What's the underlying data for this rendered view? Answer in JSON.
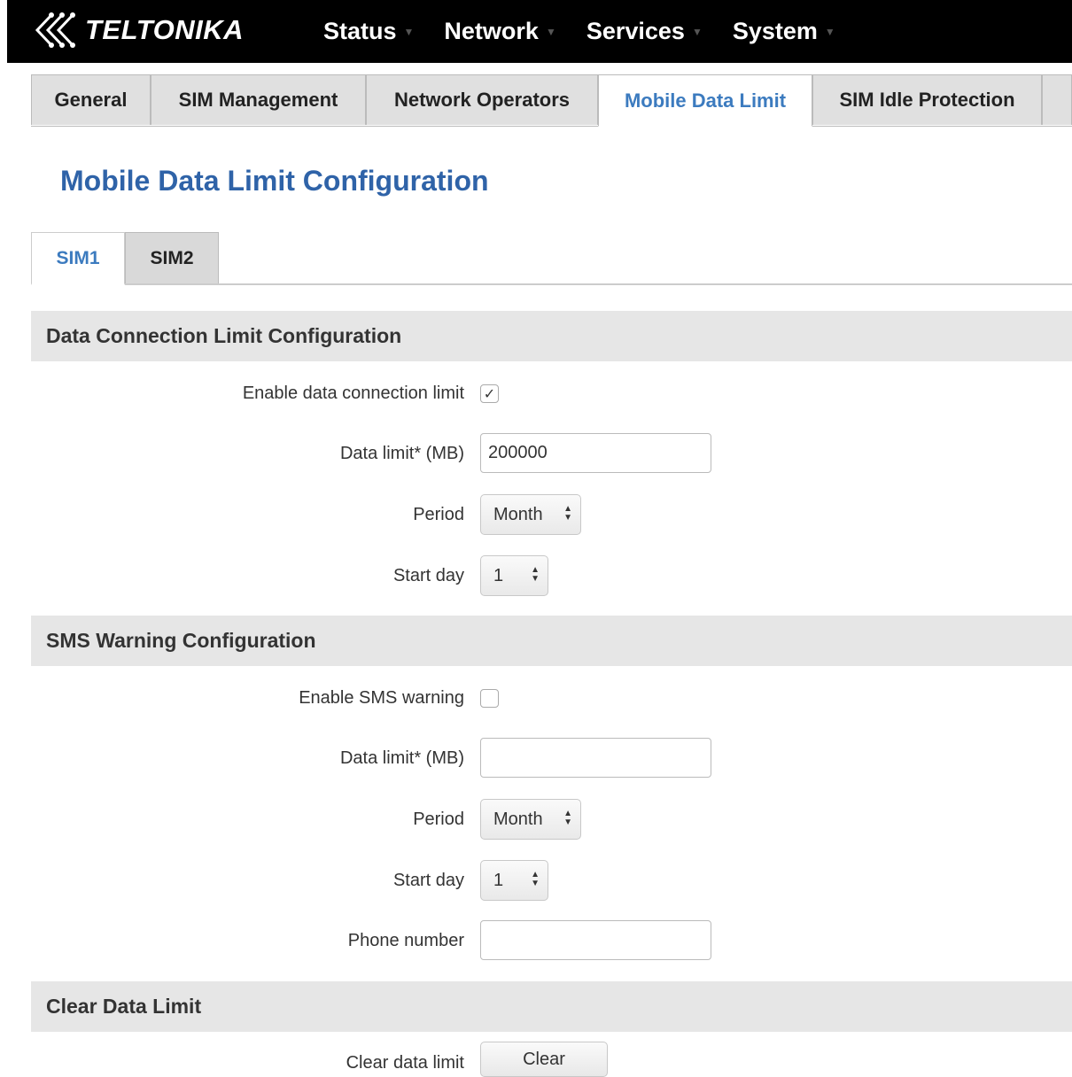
{
  "navbar": {
    "brand": "TELTONIKA",
    "menu": [
      "Status",
      "Network",
      "Services",
      "System"
    ]
  },
  "tabs": [
    "General",
    "SIM Management",
    "Network Operators",
    "Mobile Data Limit",
    "SIM Idle Protection"
  ],
  "active_tab": "Mobile Data Limit",
  "page_title": "Mobile Data Limit Configuration",
  "sim_tabs": [
    "SIM1",
    "SIM2"
  ],
  "active_sim_tab": "SIM1",
  "data_connection": {
    "heading": "Data Connection Limit Configuration",
    "enable_label": "Enable data connection limit",
    "enabled": true,
    "data_limit_label": "Data limit* (MB)",
    "data_limit_value": "200000",
    "period_label": "Period",
    "period_value": "Month",
    "start_day_label": "Start day",
    "start_day_value": "1"
  },
  "sms_warning": {
    "heading": "SMS Warning Configuration",
    "enable_label": "Enable SMS warning",
    "enabled": false,
    "data_limit_label": "Data limit* (MB)",
    "data_limit_value": "",
    "period_label": "Period",
    "period_value": "Month",
    "start_day_label": "Start day",
    "start_day_value": "1",
    "phone_label": "Phone number",
    "phone_value": ""
  },
  "clear": {
    "heading": "Clear Data Limit",
    "label": "Clear data limit",
    "button": "Clear"
  },
  "colors": {
    "accent": "#3c7bbf",
    "title": "#2f63a8",
    "navbar": "#000000",
    "section_bg": "#e6e6e6"
  }
}
